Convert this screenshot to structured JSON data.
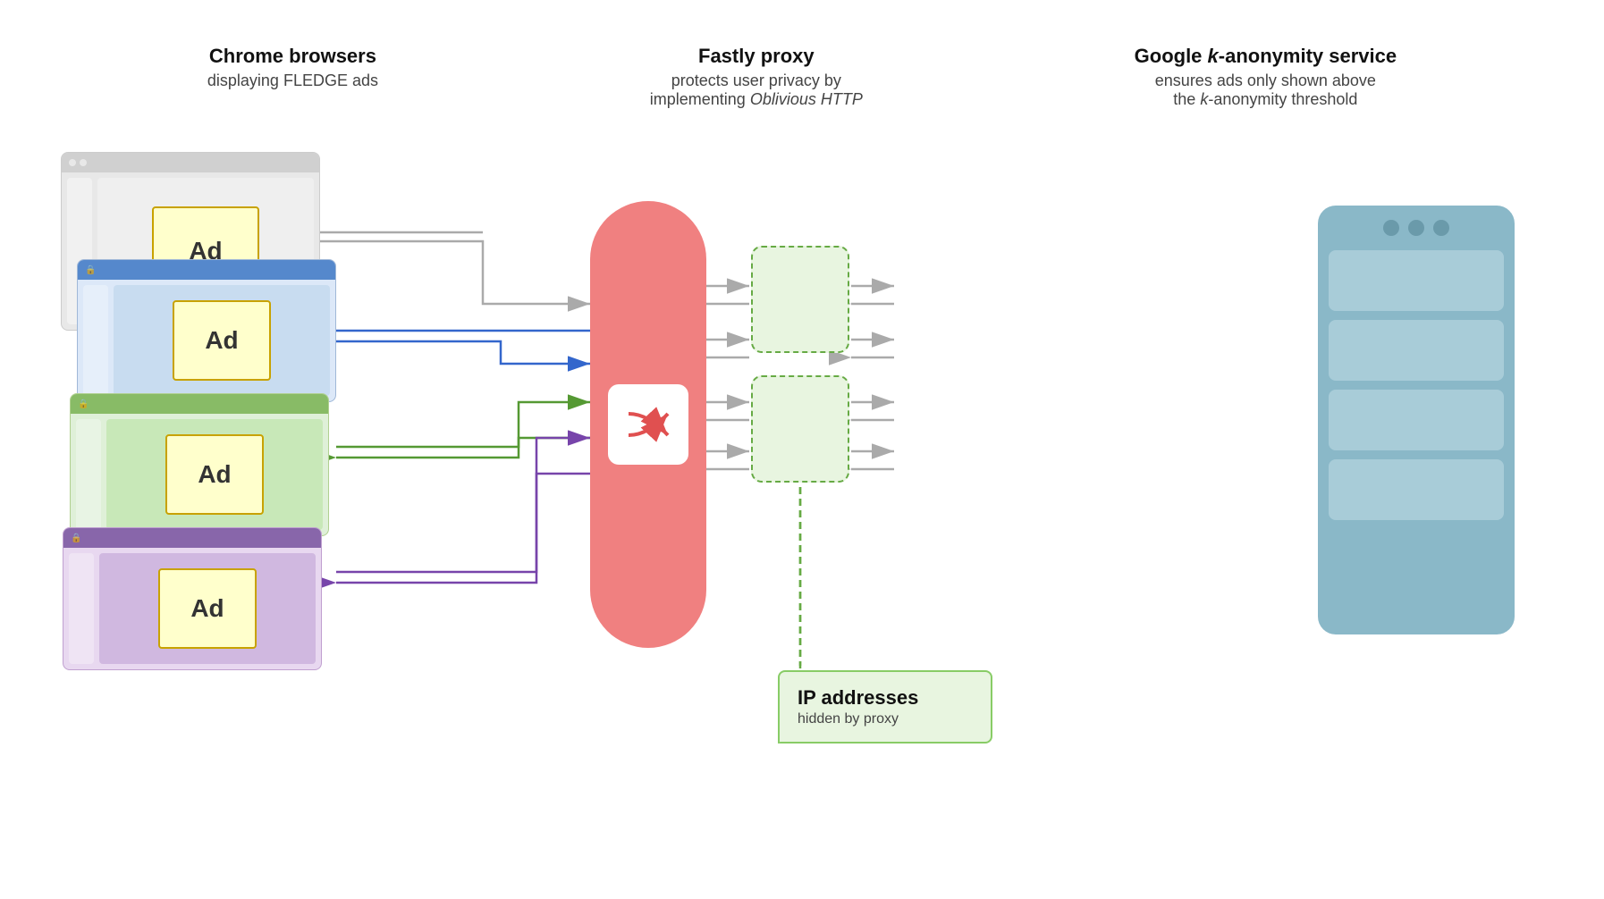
{
  "headers": {
    "col1": {
      "title": "Chrome browsers",
      "subtitle": "displaying FLEDGE ads"
    },
    "col2": {
      "title": "Fastly proxy",
      "subtitle": "protects user privacy by implementing Oblivious HTTP"
    },
    "col3": {
      "title": "Google k-anonymity service",
      "subtitle": "ensures ads only shown above the k-anonymity threshold"
    }
  },
  "browsers": {
    "ad_label": "Ad"
  },
  "ip_box": {
    "title": "IP addresses",
    "subtitle": "hidden by proxy"
  },
  "colors": {
    "blue_arrow": "#3366cc",
    "green_arrow": "#559933",
    "purple_arrow": "#7744aa",
    "gray_arrow": "#999999",
    "proxy_red": "#f08080",
    "server_teal": "#8ab8c8",
    "proxy_dashed": "#66aa44"
  }
}
